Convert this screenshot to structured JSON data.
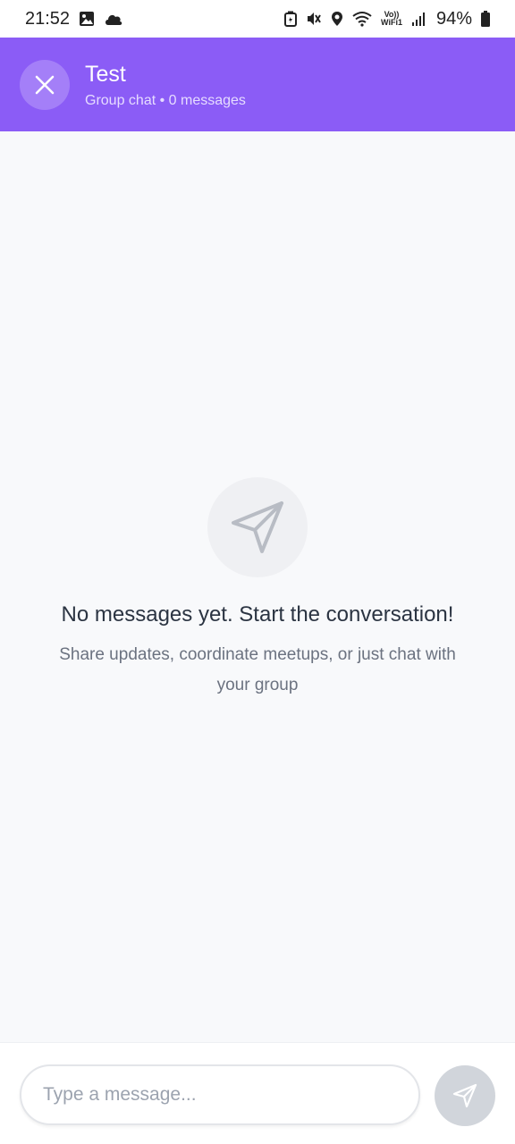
{
  "status_bar": {
    "time": "21:52",
    "battery": "94%",
    "voip_top": "Vo))",
    "voip_bottom": "WiFi1",
    "icons": [
      "image-icon",
      "cloud-icon",
      "battery-saver-icon",
      "mute-vibrate-icon",
      "location-icon",
      "wifi-icon",
      "signal-icon",
      "battery-icon"
    ]
  },
  "header": {
    "title": "Test",
    "subtitle": "Group chat • 0 messages",
    "close_icon": "close-icon",
    "background": "#8b5cf6"
  },
  "empty_state": {
    "icon": "send-icon",
    "title": "No messages yet. Start the conversation!",
    "description": "Share updates, coordinate meetups, or just chat with your group"
  },
  "composer": {
    "placeholder": "Type a message...",
    "value": "",
    "send_icon": "send-icon"
  }
}
